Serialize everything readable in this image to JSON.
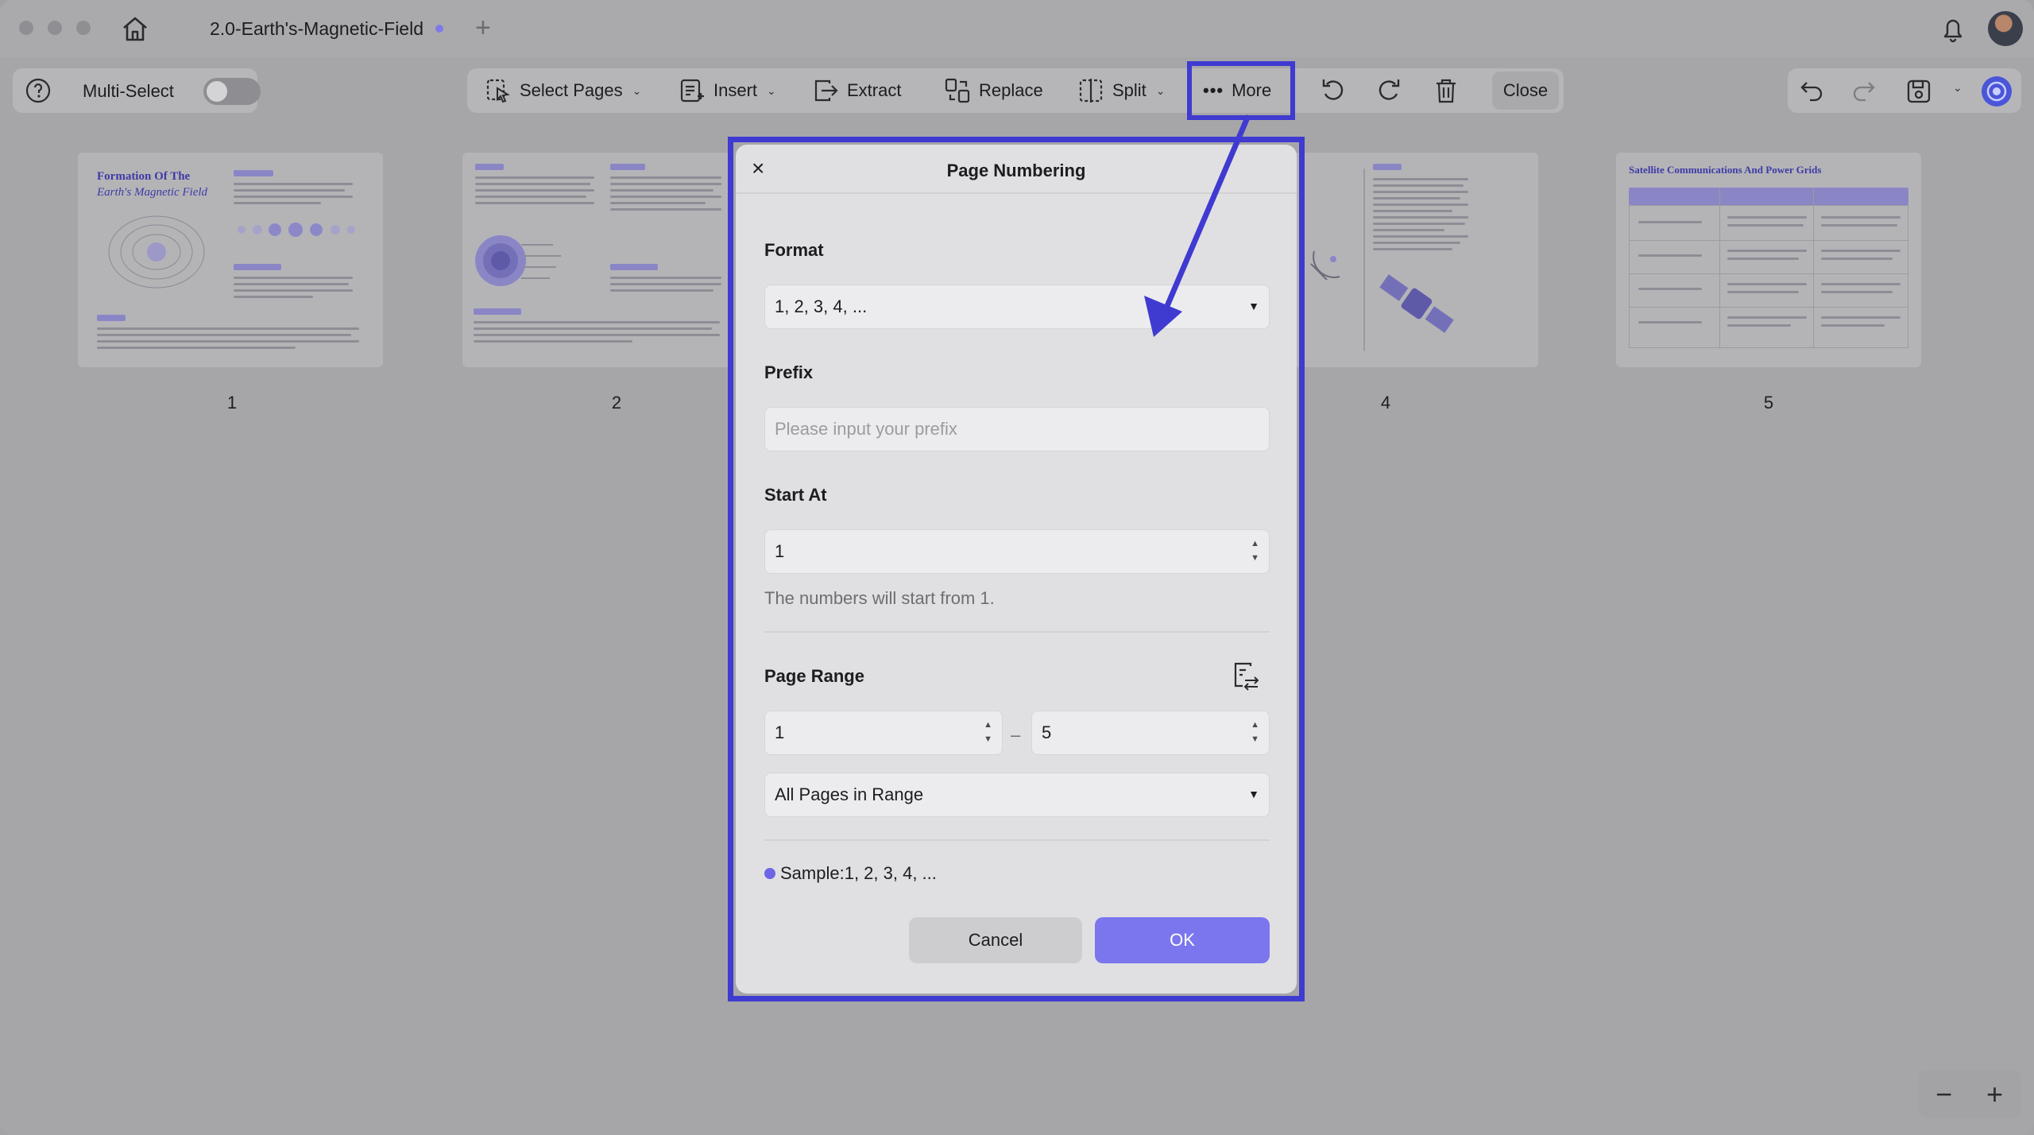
{
  "titlebar": {
    "tab_title": "2.0-Earth's-Magnetic-Field",
    "new_tab": "+"
  },
  "toolbar": {
    "multi_select_label": "Multi-Select",
    "select_pages_label": "Select Pages",
    "insert_label": "Insert",
    "extract_label": "Extract",
    "replace_label": "Replace",
    "split_label": "Split",
    "more_label": "More",
    "close_label": "Close"
  },
  "thumbnails": [
    {
      "number": "1",
      "title_line1": "Formation Of The",
      "title_line2": "Earth's Magnetic Field"
    },
    {
      "number": "2"
    },
    {
      "number": "4"
    },
    {
      "number": "5",
      "title": "Satellite Communications And Power Grids"
    }
  ],
  "dialog": {
    "close_glyph": "×",
    "title": "Page Numbering",
    "format_label": "Format",
    "format_value": "1, 2, 3, 4, ...",
    "prefix_label": "Prefix",
    "prefix_placeholder": "Please input your prefix",
    "start_at_label": "Start At",
    "start_at_value": "1",
    "start_hint": "The numbers will start from 1.",
    "page_range_label": "Page Range",
    "range_from": "1",
    "range_dash": "–",
    "range_to": "5",
    "range_mode": "All Pages in Range",
    "sample_text": "Sample:1, 2, 3, 4, ...",
    "cancel_label": "Cancel",
    "ok_label": "OK"
  },
  "zoom": {
    "minus": "−",
    "plus": "+"
  },
  "colors": {
    "accent": "#7b76ee",
    "annotation": "#3f3ad0",
    "tab_dot": "#7f7ae8"
  }
}
